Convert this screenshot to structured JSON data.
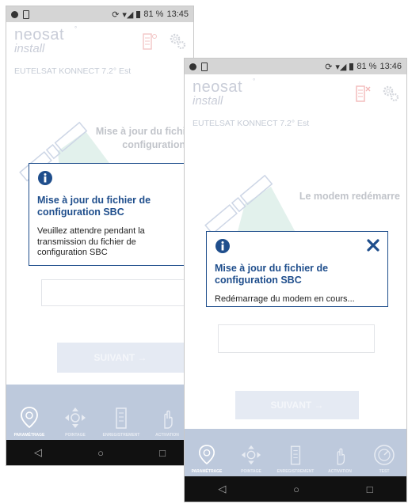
{
  "screens": {
    "screen1": {
      "status_time": "13:45",
      "status_battery": "81 %",
      "logo": {
        "main": "neosat",
        "sub": "install",
        "deg": "°"
      },
      "satellite_name": "EUTELSAT KONNECT 7.2° Est",
      "status_text_line1": "Mise à jour du fichier de",
      "status_text_line2": "configuration SBC",
      "dialog": {
        "title": "Mise à jour du fichier de configuration SBC",
        "message": "Veuillez attendre pendant la transmission du fichier de configuration SBC"
      },
      "next_label": "SUIVANT →",
      "nav": [
        "PARAMÉTRAGE",
        "POINTAGE",
        "ENREGISTREMENT",
        "ACTIVATION"
      ]
    },
    "screen2": {
      "status_time": "13:46",
      "status_battery": "81 %",
      "logo": {
        "main": "neosat",
        "sub": "install",
        "deg": "°"
      },
      "satellite_name": "EUTELSAT KONNECT 7.2° Est",
      "status_text": "Le modem redémarre",
      "dialog": {
        "title": "Mise à jour du fichier de configuration SBC",
        "message": "Redémarrage du modem en cours..."
      },
      "next_label": "SUIVANT →",
      "nav": [
        "PARAMÉTRAGE",
        "POINTAGE",
        "ENREGISTREMENT",
        "ACTIVATION",
        "TEST"
      ]
    }
  },
  "colors": {
    "dialog_border": "#1f4e8c",
    "dialog_title": "#1f4e8c",
    "navbar_bg": "#bdc9dc",
    "faded_text": "#c6ccd6",
    "satellite_beam": "#e2f1ec"
  },
  "icons": {
    "info": "info-circle-icon",
    "close": "close-x-icon",
    "nav": [
      "map-pin-icon",
      "satellite-move-icon",
      "building-icon",
      "hand-tap-icon",
      "gauge-icon"
    ],
    "sys": [
      "back-triangle-icon",
      "home-circle-icon",
      "recents-square-icon"
    ]
  }
}
